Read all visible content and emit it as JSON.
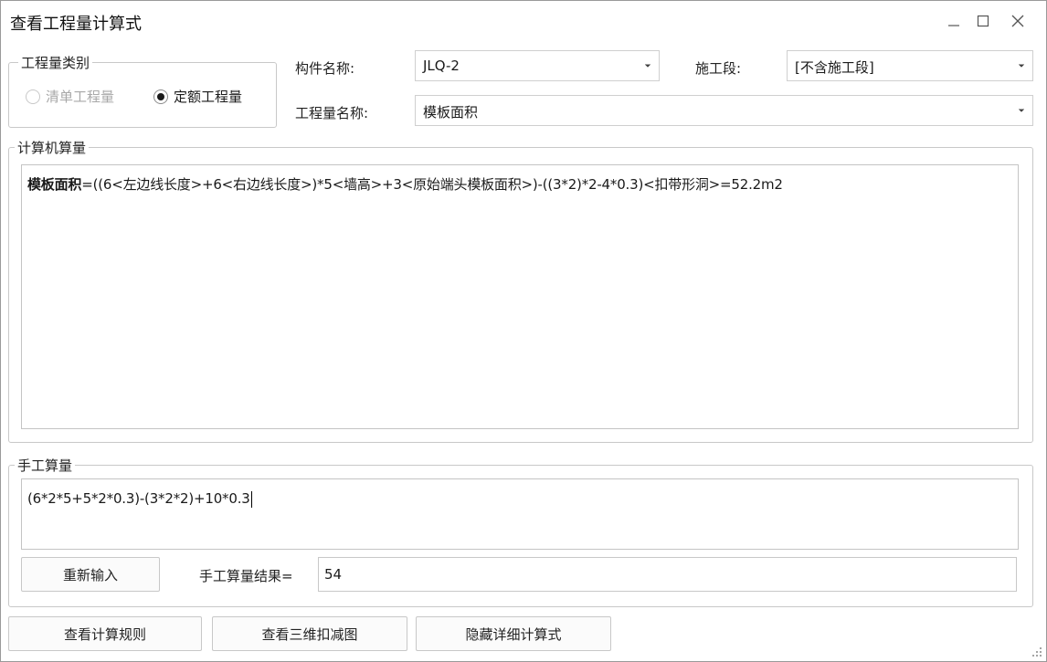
{
  "window": {
    "title": "查看工程量计算式"
  },
  "quantity_type": {
    "legend": "工程量类别",
    "options": [
      {
        "label": "清单工程量",
        "selected": false,
        "disabled": true
      },
      {
        "label": "定额工程量",
        "selected": true,
        "disabled": false
      }
    ]
  },
  "fields": {
    "component_name_label": "构件名称:",
    "component_name_value": "JLQ-2",
    "construction_stage_label": "施工段:",
    "construction_stage_value": "[不含施工段]",
    "quantity_name_label": "工程量名称:",
    "quantity_name_value": "模板面积"
  },
  "computer_calc": {
    "legend": "计算机算量",
    "formula_name": "模板面积",
    "formula_body": "=((6<左边线长度>+6<右边线长度>)*5<墙高>+3<原始端头模板面积>)-((3*2)*2-4*0.3)<扣带形洞>=52.2m2"
  },
  "manual_calc": {
    "legend": "手工算量",
    "expression": "(6*2*5+5*2*0.3)-(3*2*2)+10*0.3",
    "reenter_label": "重新输入",
    "result_label": "手工算量结果=",
    "result_value": "54"
  },
  "footer": {
    "view_rules_label": "查看计算规则",
    "view_3d_label": "查看三维扣减图",
    "hide_detail_label": "隐藏详细计算式"
  }
}
